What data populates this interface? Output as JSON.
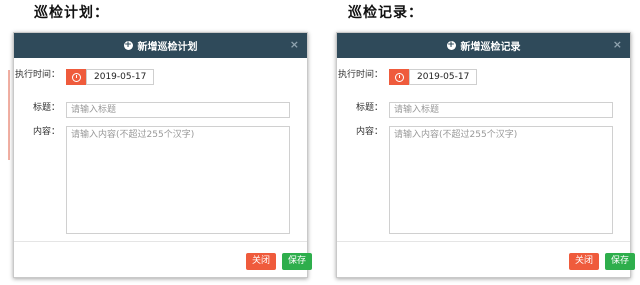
{
  "sections": {
    "left_title": "巡检计划：",
    "right_title": "巡检记录："
  },
  "left_dialog": {
    "title": "新增巡检计划",
    "exec_time_label": "执行时间：",
    "date_value": "2019-05-17",
    "title_label": "标题：",
    "title_placeholder": "请输入标题",
    "content_label": "内容：",
    "content_placeholder": "请输入内容(不超过255个汉字)",
    "close_button": "关闭",
    "save_button": "保存"
  },
  "right_dialog": {
    "title": "新增巡检记录",
    "exec_time_label": "执行时间：",
    "date_value": "2019-05-17",
    "title_label": "标题：",
    "title_placeholder": "请输入标题",
    "content_label": "内容：",
    "content_placeholder": "请输入内容(不超过255个汉字)",
    "close_button": "关闭",
    "save_button": "保存"
  },
  "colors": {
    "header": "#2f4a5a",
    "danger": "#ef5b3c",
    "success": "#2eae4c"
  },
  "icons": [
    "plus-circle-icon",
    "close-icon",
    "clock-icon"
  ]
}
